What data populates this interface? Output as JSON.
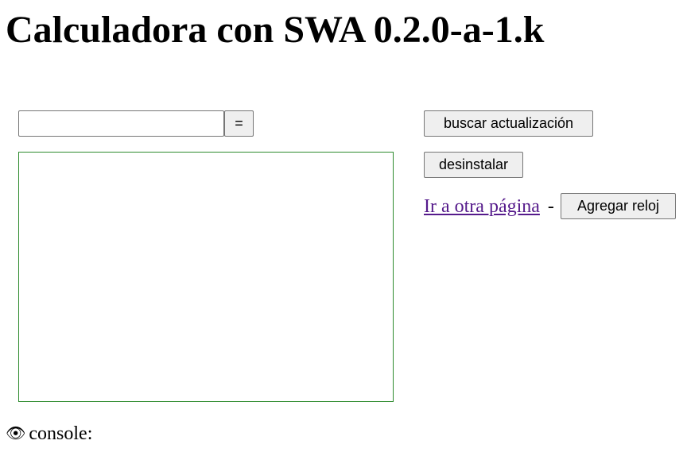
{
  "page": {
    "title": "Calculadora con SWA 0.2.0-a-1.k"
  },
  "calculator": {
    "input_value": "",
    "equals_label": "=",
    "output_text": ""
  },
  "actions": {
    "update_label": "buscar actualización",
    "uninstall_label": "desinstalar",
    "other_page_link": "Ir a otra página",
    "separator": "-",
    "add_clock_label": "Agregar reloj"
  },
  "console": {
    "icon": "eye-icon",
    "label": "console:"
  }
}
